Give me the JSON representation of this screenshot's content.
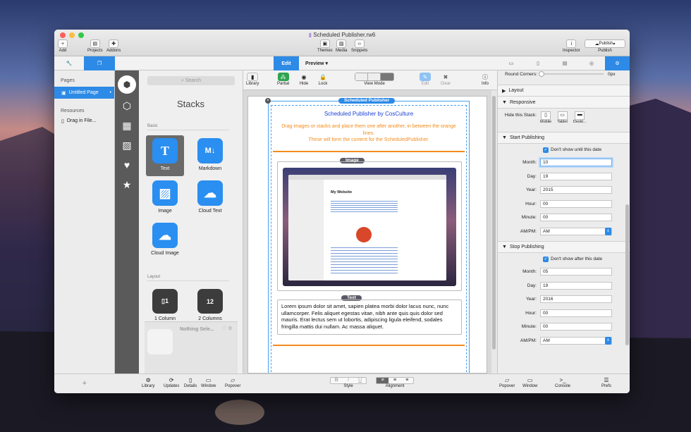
{
  "window": {
    "title": "Scheduled Publisher.rw6"
  },
  "toolbar": {
    "add": "Add",
    "projects": "Projects",
    "addons": "Addons",
    "themes": "Themes",
    "media": "Media",
    "snippets": "Snippets",
    "inspector": "Inspector",
    "publish": "Publish",
    "publish_btn": "Publish"
  },
  "modes": {
    "edit": "Edit",
    "preview": "Preview"
  },
  "pages": {
    "header": "Pages",
    "page_name": "Untitled Page",
    "resources_header": "Resources",
    "drag_files": "Drag in File..."
  },
  "stacks_panel": {
    "search_placeholder": "Search",
    "title": "Stacks",
    "sections": {
      "basic": "Basic",
      "layout": "Layout"
    },
    "items": [
      "Text",
      "Markdown",
      "Image",
      "Cloud Text",
      "Cloud Image",
      "1 Column",
      "2 Columns"
    ],
    "nothing_selected": "Nothing Sele..."
  },
  "canvas_toolbar": {
    "library": "Library",
    "partial": "Partial",
    "hide": "Hide",
    "lock": "Lock",
    "view_mode": "View Mode",
    "edit": "Edit",
    "clear": "Clear",
    "info": "Info"
  },
  "canvas": {
    "badge": "Scheduled Publisher",
    "heading": "Scheduled Publisher by CosCulture",
    "instructions": "Drag images or stacks and place them one after another, in between the orange lines.",
    "instructions2": "These will form the content for the ScheduledPublisher.",
    "image_badge": "Image",
    "text_badge": "Text",
    "thumb_title": "My Website",
    "lorem": "Lorem ipsum dolor sit amet, sapien platea morbi dolor lacus nunc, nunc ullamcorper. Felis aliquet egestas vitae, nibh ante quis quis dolor sed mauris. Erat lectus sem ut lobortis, adipiscing ligula eleifend, sodales fringilla mattis dui nullam. Ac massa aliquet."
  },
  "inspector": {
    "round_corners": "Round Corners:",
    "round_value": "0px",
    "layout": "Layout",
    "responsive": "Responsive",
    "hide_stack": "Hide this Stack:",
    "devices": [
      "Mobile",
      "Tablet",
      "Deskt..."
    ],
    "start": {
      "header": "Start Publishing",
      "checkbox": "Don't show until this date",
      "labels": [
        "Month:",
        "Day:",
        "Year:",
        "Hour:",
        "Minute:"
      ],
      "values": [
        "10",
        "19",
        "2015",
        "00",
        "00"
      ],
      "ampm_label": "AM/PM:",
      "ampm": "AM"
    },
    "stop": {
      "header": "Stop Publishing",
      "checkbox": "Don't show after this date",
      "labels": [
        "Month:",
        "Day:",
        "Year:",
        "Hour:",
        "Minute:"
      ],
      "values": [
        "05",
        "19",
        "2016",
        "00",
        "00"
      ],
      "ampm_label": "AM/PM:",
      "ampm": "AM"
    }
  },
  "bottom": {
    "library": "Library",
    "updates": "Updates",
    "details": "Details",
    "window": "Window",
    "popover": "Popover",
    "style": "Style",
    "alignment": "Alignment",
    "popover2": "Popover",
    "window2": "Window",
    "console": "Console",
    "prefs": "Prefs"
  },
  "colors": {
    "accent": "#2d8ae6",
    "orange": "#f28c1c",
    "brand_blue": "#1a3fd4"
  }
}
